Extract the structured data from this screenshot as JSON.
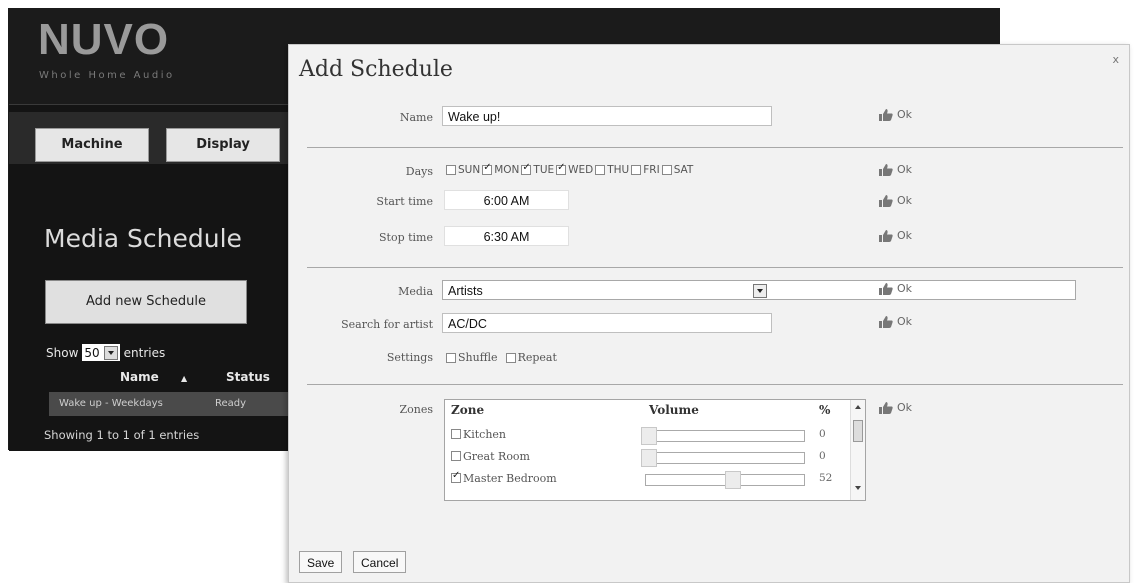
{
  "background_app": {
    "logo_text": "NUVO",
    "logo_sub": "Whole Home Audio",
    "tabs": [
      {
        "label": "Machine"
      },
      {
        "label": "Display"
      }
    ],
    "title": "Media Schedule",
    "add_button": "Add new Schedule",
    "show_label": "Show",
    "entries_value": "50",
    "entries_label": "entries",
    "table_headers": [
      {
        "label": "Name"
      },
      {
        "label": "Status"
      }
    ],
    "rows": [
      {
        "name": "Wake up - Weekdays",
        "status": "Ready"
      }
    ],
    "showing_text": "Showing 1 to 1 of 1 entries"
  },
  "dialog": {
    "title": "Add Schedule",
    "close": "x",
    "ok_label": "Ok",
    "name": {
      "label": "Name",
      "value": "Wake up!"
    },
    "days": {
      "label": "Days",
      "items": [
        {
          "label": "SUN",
          "checked": false
        },
        {
          "label": "MON",
          "checked": true
        },
        {
          "label": "TUE",
          "checked": true
        },
        {
          "label": "WED",
          "checked": true
        },
        {
          "label": "THU",
          "checked": false
        },
        {
          "label": "FRI",
          "checked": false
        },
        {
          "label": "SAT",
          "checked": false
        }
      ]
    },
    "start_time": {
      "label": "Start time",
      "value": "6:00 AM"
    },
    "stop_time": {
      "label": "Stop time",
      "value": "6:30 AM"
    },
    "media": {
      "label": "Media",
      "value": "Artists"
    },
    "search": {
      "label": "Search for artist",
      "value": "AC/DC"
    },
    "settings": {
      "label": "Settings",
      "shuffle": "Shuffle",
      "repeat": "Repeat"
    },
    "zones": {
      "label": "Zones",
      "headers": {
        "zone": "Zone",
        "volume": "Volume",
        "pct": "%"
      },
      "rows": [
        {
          "name": "Kitchen",
          "checked": false,
          "volume": 0
        },
        {
          "name": "Great Room",
          "checked": false,
          "volume": 0
        },
        {
          "name": "Master Bedroom",
          "checked": true,
          "volume": 52
        }
      ]
    },
    "save": "Save",
    "cancel": "Cancel"
  }
}
